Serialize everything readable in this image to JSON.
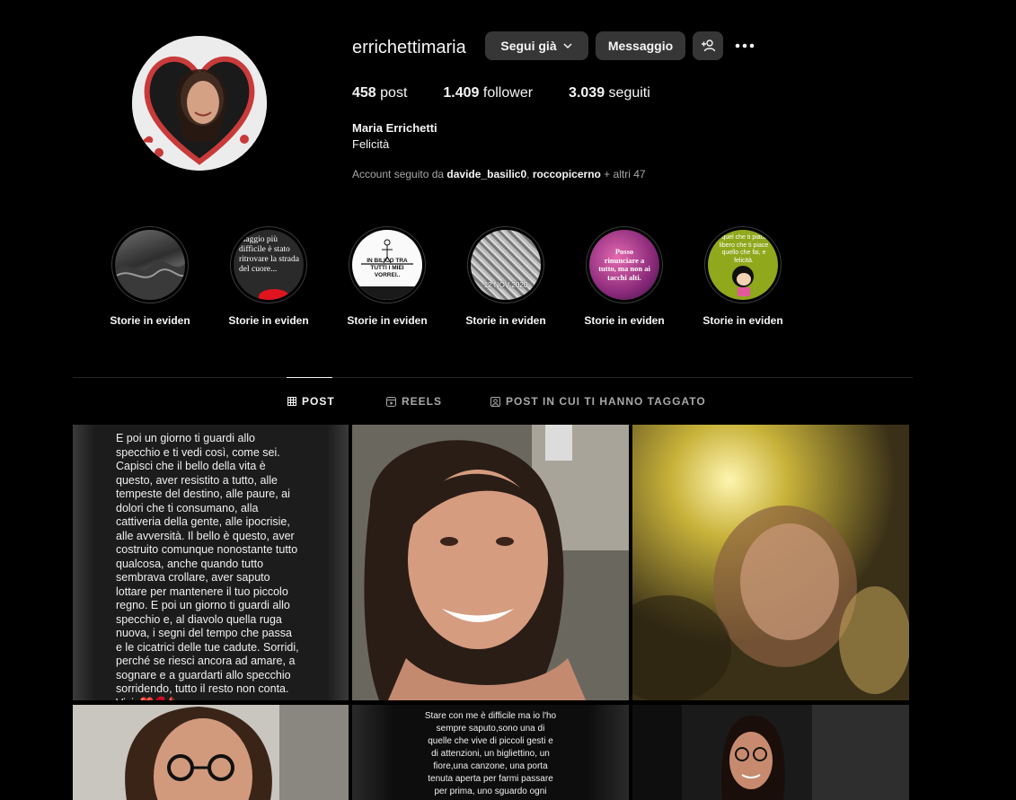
{
  "profile": {
    "username": "errichettimaria",
    "follow_button": "Segui già",
    "message_button": "Messaggio",
    "posts_count": "458",
    "posts_label": "post",
    "followers_count": "1.409",
    "followers_label": "follower",
    "following_count": "3.039",
    "following_label": "seguiti",
    "full_name": "Maria Errichetti",
    "bio": "Felicità",
    "followed_prefix": "Account seguito da",
    "followed_user1": "davide_basilic0",
    "followed_sep": ",",
    "followed_user2": "roccopicerno",
    "followed_suffix": "+ altri 47"
  },
  "highlights": [
    {
      "label": "Storie in eviden",
      "text": ""
    },
    {
      "label": "Storie in eviden",
      "text": "viaggio più difficile è stato ritrovare la strada del cuore..."
    },
    {
      "label": "Storie in eviden",
      "text": "IN BILICO TRA TUTTI I MIEI VORREI.."
    },
    {
      "label": "Storie in eviden",
      "text": "12 NOV 2020"
    },
    {
      "label": "Storie in eviden",
      "text": "Posso rinunciare a tutto, ma non ai tacchi alti."
    },
    {
      "label": "Storie in eviden",
      "text": "fai quel che ti piace, è libero che ti piace quello che fai, e felicità."
    }
  ],
  "tabs": {
    "posts": "POST",
    "reels": "REELS",
    "tagged": "POST IN CUI TI HANNO TAGGATO"
  },
  "posts": {
    "quote1": "E poi un giorno ti guardi allo specchio e ti vedi così, come sei. Capisci che il bello della vita è questo, aver resistito a tutto, alle tempeste del destino, alle paure, ai dolori che ti consumano, alla cattiveria della gente, alle ipocrisie, alle avversità. Il bello è questo, aver costruito comunque nonostante tutto qualcosa, anche quando tutto sembrava crollare, aver saputo lottare per mantenere il tuo piccolo regno. E poi un giorno ti guardi allo specchio e, al diavolo quella ruga nuova, i segni del tempo che passa e le cicatrici delle tue cadute. Sorridi, perché se riesci ancora ad amare, a sognare e a guardarti allo specchio sorridendo, tutto il resto non conta. Vivi. ❤️🌹👠",
    "quote2": "Stare con me è difficile ma io l'ho sempre saputo,sono una di quelle che vive di piccoli gesti e di attenzioni, un bigliettino, un fiore,una canzone, una porta tenuta aperta per farmi passare per prima, uno sguardo ogni"
  },
  "colors": {
    "background": "#000000",
    "button": "#363636",
    "muted_text": "#a8a8a8",
    "heart": "#c93a3a"
  }
}
